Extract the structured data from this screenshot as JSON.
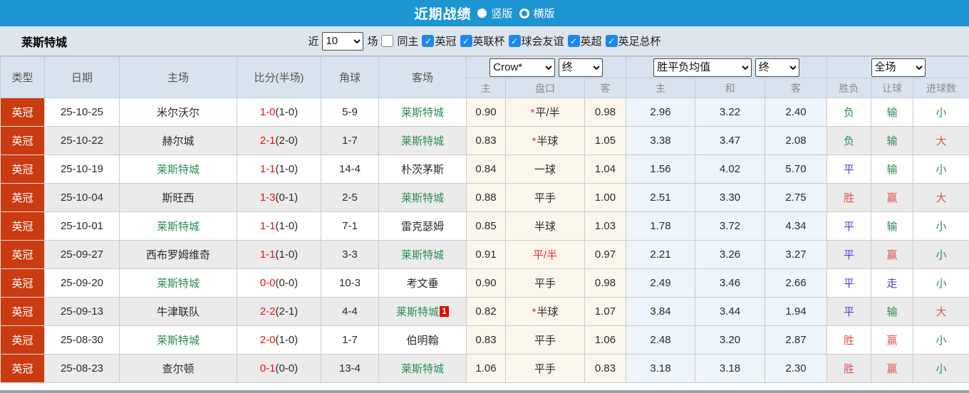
{
  "title_bar": {
    "title": "近期战绩",
    "layout_options": [
      {
        "label": "竖版",
        "selected": true
      },
      {
        "label": "横版",
        "selected": false
      }
    ]
  },
  "filter_bar": {
    "team_name": "莱斯特城",
    "recent_label": "近",
    "recent_value": "10",
    "matches_label": "场",
    "same_home_label": "同主",
    "same_home_checked": false,
    "competitions": [
      {
        "label": "英冠",
        "checked": true
      },
      {
        "label": "英联杯",
        "checked": true
      },
      {
        "label": "球会友谊",
        "checked": true
      },
      {
        "label": "英超",
        "checked": true
      },
      {
        "label": "英足总杯",
        "checked": true
      }
    ]
  },
  "icons": {
    "check": "✓"
  },
  "colors": {
    "accent_blue": "#1D95D3",
    "league_red": "#CB3B11",
    "team_green": "#2E8B57",
    "score_red": "#EE1111",
    "handicap_red": "#E83333",
    "star_red": "#FF2222",
    "text_dark": "#2B2B2B",
    "checkbox_blue": "#1E88F2",
    "result": {
      "green": "#2E8B57",
      "red": "#E05555",
      "blue": "#4545CF"
    }
  },
  "table": {
    "columns": [
      "类型",
      "日期",
      "主场",
      "比分(半场)",
      "角球",
      "客场"
    ],
    "odds_group": {
      "selects": [
        "Crow*",
        "终"
      ],
      "subcols": [
        "主",
        "盘口",
        "客"
      ]
    },
    "avg_group": {
      "selects": [
        "胜平负均值",
        "终"
      ],
      "subcols": [
        "主",
        "和",
        "客"
      ]
    },
    "result_group": {
      "selects": [
        "全场"
      ],
      "subcols": [
        "胜负",
        "让球",
        "进球数"
      ]
    },
    "rows": [
      {
        "league": "英冠",
        "date": "25-10-25",
        "home": {
          "name": "米尔沃尔",
          "highlight": false
        },
        "score": {
          "full": "1-0",
          "half": "(1-0)"
        },
        "corners": "5-9",
        "away": {
          "name": "莱斯特城",
          "highlight": true,
          "badge": ""
        },
        "odds": {
          "home": "0.90",
          "handicap": "平/半",
          "star": true,
          "handicap_red": false,
          "away": "0.98"
        },
        "avg": {
          "win": "2.96",
          "draw": "3.22",
          "lose": "2.40"
        },
        "result": {
          "outcome": {
            "text": "负",
            "color": "green"
          },
          "handicap": {
            "text": "输",
            "color": "green"
          },
          "goals": {
            "text": "小",
            "color": "green"
          }
        }
      },
      {
        "league": "英冠",
        "date": "25-10-22",
        "home": {
          "name": "赫尔城",
          "highlight": false
        },
        "score": {
          "full": "2-1",
          "half": "(2-0)"
        },
        "corners": "1-7",
        "away": {
          "name": "莱斯特城",
          "highlight": true,
          "badge": ""
        },
        "odds": {
          "home": "0.83",
          "handicap": "半球",
          "star": true,
          "handicap_red": false,
          "away": "1.05"
        },
        "avg": {
          "win": "3.38",
          "draw": "3.47",
          "lose": "2.08"
        },
        "result": {
          "outcome": {
            "text": "负",
            "color": "green"
          },
          "handicap": {
            "text": "输",
            "color": "green"
          },
          "goals": {
            "text": "大",
            "color": "red"
          }
        }
      },
      {
        "league": "英冠",
        "date": "25-10-19",
        "home": {
          "name": "莱斯特城",
          "highlight": true
        },
        "score": {
          "full": "1-1",
          "half": "(1-0)"
        },
        "corners": "14-4",
        "away": {
          "name": "朴茨茅斯",
          "highlight": false,
          "badge": ""
        },
        "odds": {
          "home": "0.84",
          "handicap": "一球",
          "star": false,
          "handicap_red": false,
          "away": "1.04"
        },
        "avg": {
          "win": "1.56",
          "draw": "4.02",
          "lose": "5.70"
        },
        "result": {
          "outcome": {
            "text": "平",
            "color": "blue"
          },
          "handicap": {
            "text": "输",
            "color": "green"
          },
          "goals": {
            "text": "小",
            "color": "green"
          }
        }
      },
      {
        "league": "英冠",
        "date": "25-10-04",
        "home": {
          "name": "斯旺西",
          "highlight": false
        },
        "score": {
          "full": "1-3",
          "half": "(0-1)"
        },
        "corners": "2-5",
        "away": {
          "name": "莱斯特城",
          "highlight": true,
          "badge": ""
        },
        "odds": {
          "home": "0.88",
          "handicap": "平手",
          "star": false,
          "handicap_red": false,
          "away": "1.00"
        },
        "avg": {
          "win": "2.51",
          "draw": "3.30",
          "lose": "2.75"
        },
        "result": {
          "outcome": {
            "text": "胜",
            "color": "red"
          },
          "handicap": {
            "text": "赢",
            "color": "red"
          },
          "goals": {
            "text": "大",
            "color": "red"
          }
        }
      },
      {
        "league": "英冠",
        "date": "25-10-01",
        "home": {
          "name": "莱斯特城",
          "highlight": true
        },
        "score": {
          "full": "1-1",
          "half": "(1-0)"
        },
        "corners": "7-1",
        "away": {
          "name": "雷克瑟姆",
          "highlight": false,
          "badge": ""
        },
        "odds": {
          "home": "0.85",
          "handicap": "半球",
          "star": false,
          "handicap_red": false,
          "away": "1.03"
        },
        "avg": {
          "win": "1.78",
          "draw": "3.72",
          "lose": "4.34"
        },
        "result": {
          "outcome": {
            "text": "平",
            "color": "blue"
          },
          "handicap": {
            "text": "输",
            "color": "green"
          },
          "goals": {
            "text": "小",
            "color": "green"
          }
        }
      },
      {
        "league": "英冠",
        "date": "25-09-27",
        "home": {
          "name": "西布罗姆维奇",
          "highlight": false
        },
        "score": {
          "full": "1-1",
          "half": "(1-0)"
        },
        "corners": "3-3",
        "away": {
          "name": "莱斯特城",
          "highlight": true,
          "badge": ""
        },
        "odds": {
          "home": "0.91",
          "handicap": "平/半",
          "star": false,
          "handicap_red": true,
          "away": "0.97"
        },
        "avg": {
          "win": "2.21",
          "draw": "3.26",
          "lose": "3.27"
        },
        "result": {
          "outcome": {
            "text": "平",
            "color": "blue"
          },
          "handicap": {
            "text": "赢",
            "color": "red"
          },
          "goals": {
            "text": "小",
            "color": "green"
          }
        }
      },
      {
        "league": "英冠",
        "date": "25-09-20",
        "home": {
          "name": "莱斯特城",
          "highlight": true
        },
        "score": {
          "full": "0-0",
          "half": "(0-0)"
        },
        "corners": "10-3",
        "away": {
          "name": "考文垂",
          "highlight": false,
          "badge": ""
        },
        "odds": {
          "home": "0.90",
          "handicap": "平手",
          "star": false,
          "handicap_red": false,
          "away": "0.98"
        },
        "avg": {
          "win": "2.49",
          "draw": "3.46",
          "lose": "2.66"
        },
        "result": {
          "outcome": {
            "text": "平",
            "color": "blue"
          },
          "handicap": {
            "text": "走",
            "color": "blue"
          },
          "goals": {
            "text": "小",
            "color": "green"
          }
        }
      },
      {
        "league": "英冠",
        "date": "25-09-13",
        "home": {
          "name": "牛津联队",
          "highlight": false
        },
        "score": {
          "full": "2-2",
          "half": "(2-1)"
        },
        "corners": "4-4",
        "away": {
          "name": "莱斯特城",
          "highlight": true,
          "badge": "1"
        },
        "odds": {
          "home": "0.82",
          "handicap": "半球",
          "star": true,
          "handicap_red": false,
          "away": "1.07"
        },
        "avg": {
          "win": "3.84",
          "draw": "3.44",
          "lose": "1.94"
        },
        "result": {
          "outcome": {
            "text": "平",
            "color": "blue"
          },
          "handicap": {
            "text": "输",
            "color": "green"
          },
          "goals": {
            "text": "大",
            "color": "red"
          }
        }
      },
      {
        "league": "英冠",
        "date": "25-08-30",
        "home": {
          "name": "莱斯特城",
          "highlight": true
        },
        "score": {
          "full": "2-0",
          "half": "(1-0)"
        },
        "corners": "1-7",
        "away": {
          "name": "伯明翰",
          "highlight": false,
          "badge": ""
        },
        "odds": {
          "home": "0.83",
          "handicap": "平手",
          "star": false,
          "handicap_red": false,
          "away": "1.06"
        },
        "avg": {
          "win": "2.48",
          "draw": "3.20",
          "lose": "2.87"
        },
        "result": {
          "outcome": {
            "text": "胜",
            "color": "red"
          },
          "handicap": {
            "text": "赢",
            "color": "red"
          },
          "goals": {
            "text": "小",
            "color": "green"
          }
        }
      },
      {
        "league": "英冠",
        "date": "25-08-23",
        "home": {
          "name": "查尔顿",
          "highlight": false
        },
        "score": {
          "full": "0-1",
          "half": "(0-0)"
        },
        "corners": "13-4",
        "away": {
          "name": "莱斯特城",
          "highlight": true,
          "badge": ""
        },
        "odds": {
          "home": "1.06",
          "handicap": "平手",
          "star": false,
          "handicap_red": false,
          "away": "0.83"
        },
        "avg": {
          "win": "3.18",
          "draw": "3.18",
          "lose": "2.30"
        },
        "result": {
          "outcome": {
            "text": "胜",
            "color": "red"
          },
          "handicap": {
            "text": "赢",
            "color": "red"
          },
          "goals": {
            "text": "小",
            "color": "green"
          }
        }
      }
    ]
  }
}
